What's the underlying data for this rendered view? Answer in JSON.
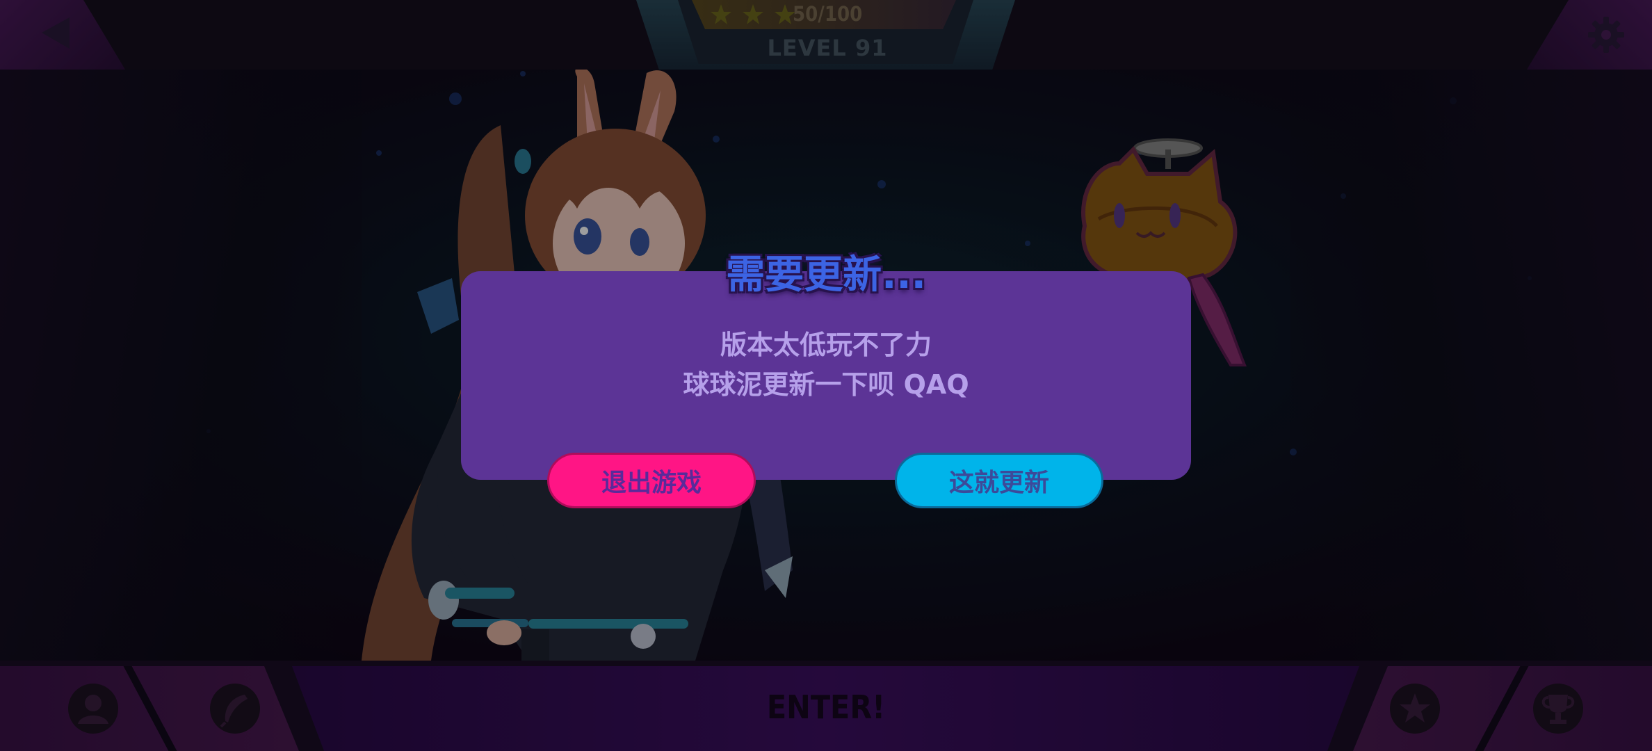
{
  "top_bar": {
    "stars": {
      "filled": 3,
      "total": 3,
      "count_text": "50/100"
    },
    "level_text": "LEVEL 91"
  },
  "bottom_bar": {
    "enter_label": "ENTER!"
  },
  "dialog": {
    "title": "需要更新...",
    "message_line1": "版本太低玩不了力",
    "message_line2": "球球泥更新一下呗 QAQ",
    "exit_button": "退出游戏",
    "update_button": "这就更新"
  },
  "colors": {
    "dialog_bg": "#5c3496",
    "title": "#3c64e4",
    "exit_button": "#ff1585",
    "update_button": "#00b4ea"
  },
  "icons": [
    "back-arrow-icon",
    "gear-icon",
    "star-icon",
    "profile-icon",
    "feather-icon",
    "star-badge-icon",
    "trophy-icon"
  ]
}
